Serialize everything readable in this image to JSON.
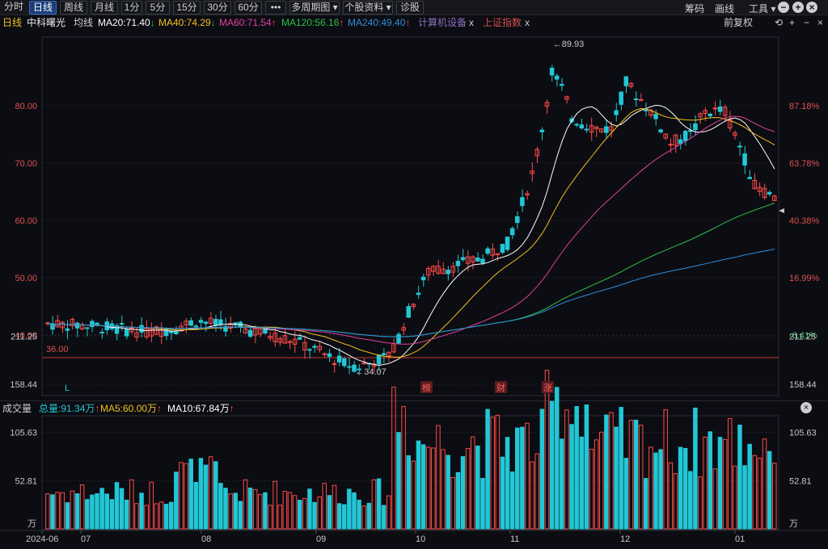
{
  "toolbar": {
    "tabs": [
      "分时",
      "日线",
      "周线",
      "月线",
      "1分",
      "5分",
      "15分",
      "30分",
      "60分",
      "•••",
      "多周期图 ▾",
      "个股资料 ▾",
      "诊股"
    ],
    "active": "日线",
    "right": [
      "筹码",
      "画线",
      "工具 ▾"
    ]
  },
  "stock": {
    "period": "日线",
    "name": "中科曙光",
    "avg_label": "均线",
    "ma20": "MA20:71.40",
    "ma40": "MA40:74.29",
    "ma60": "MA60:71.54",
    "ma120": "MA120:56.16",
    "ma240": "MA240:49.40",
    "overlay1": "计算机设备",
    "overlay2": "上证指数",
    "close_x": "x",
    "adjust": "前复权"
  },
  "volume_info": {
    "title": "成交量",
    "total": "总量:91.34万",
    "ma5": "MA5:60.00万",
    "ma10": "MA10:67.84万",
    "close_x": "×"
  },
  "colors": {
    "up": "#ff4a4a",
    "down": "#22c7d6",
    "bg": "#0c0d12",
    "ma5": "#ffffff",
    "ma10": "#f0c020",
    "ma20": "#e040a0",
    "ma60": "#2ec04a",
    "ma120": "#2f8fe0",
    "ref_line": "#c83232"
  },
  "chart_data": {
    "type": "candlestick",
    "price_axis": {
      "left_ticks": [
        "80.00",
        "70.00",
        "60.00",
        "50.00",
        "40.00"
      ],
      "left_values": [
        80,
        70,
        60,
        50,
        40
      ],
      "right_ticks": [
        "87.18%",
        "63.78%",
        "40.38%",
        "16.99%",
        "-6.41%"
      ]
    },
    "reference_price": "36.00",
    "high_label": "89.93",
    "low_label": "34.07",
    "event_markers": [
      "榜",
      "财",
      "涨"
    ],
    "corner_marker": "L",
    "volume_axis": {
      "ticks": [
        "211.25",
        "158.44",
        "105.63",
        "52.81"
      ],
      "values": [
        211.25,
        158.44,
        105.63,
        52.81
      ],
      "unit": "万"
    },
    "date_labels": [
      "2024-06",
      "07",
      "08",
      "09",
      "10",
      "11",
      "12",
      "01"
    ],
    "series_colors": {
      "ma_white": "#ffffff",
      "ma_yellow": "#f0c020",
      "ma_magenta": "#e040a0",
      "ma_green": "#2ec04a",
      "ma_blue": "#2f8fe0"
    }
  }
}
